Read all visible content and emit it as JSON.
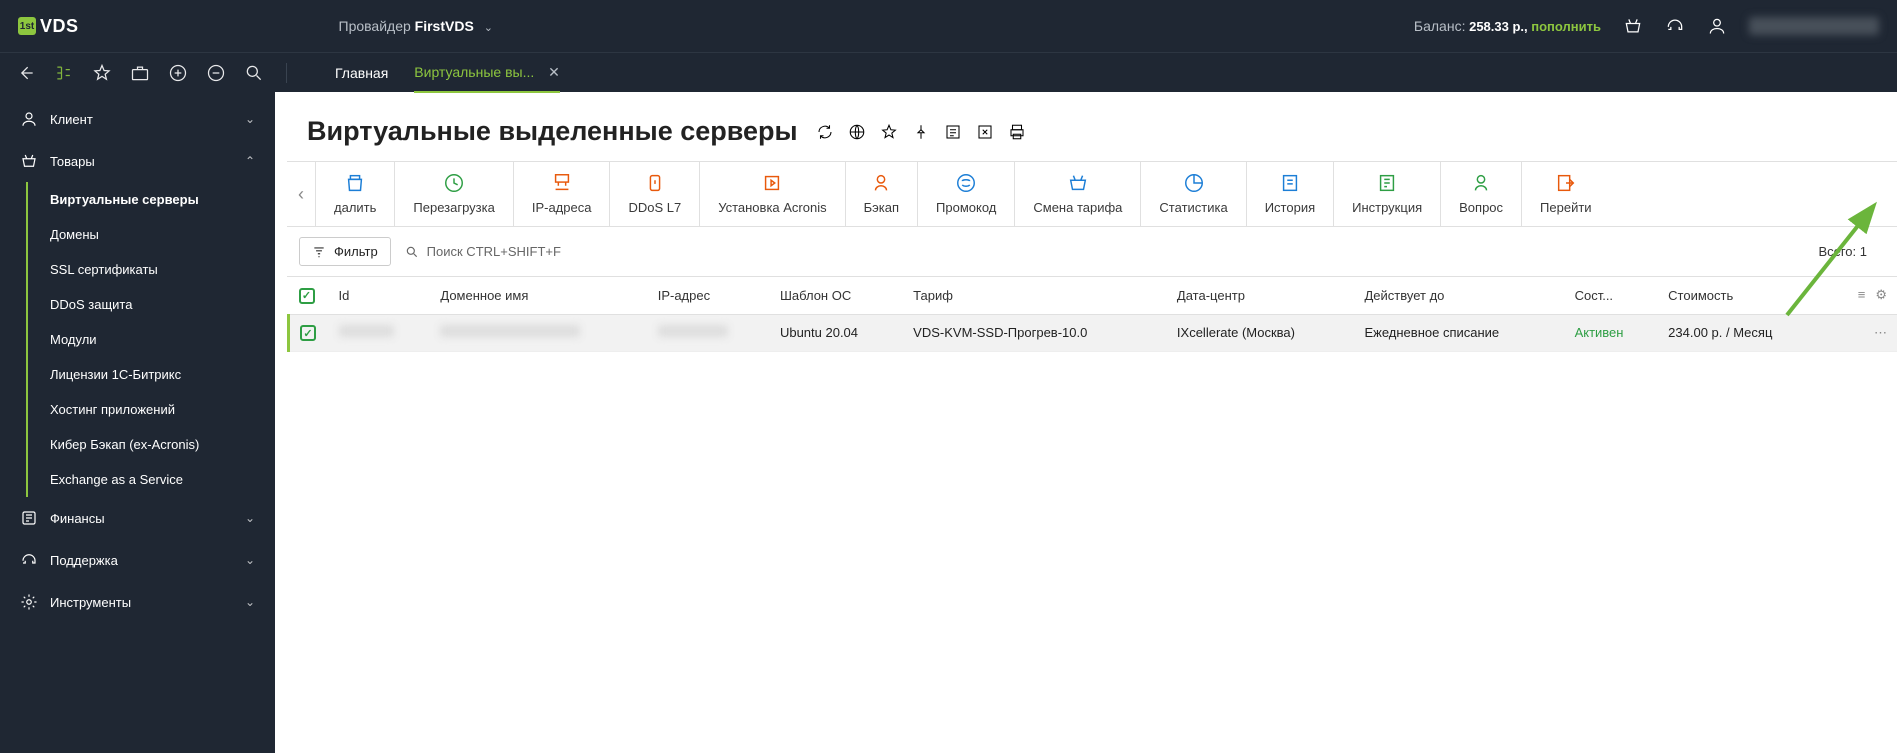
{
  "header": {
    "provider_label": "Провайдер",
    "provider": "FirstVDS",
    "balance_label": "Баланс:",
    "balance_value": "258.33 р.,",
    "topup": "пополнить",
    "user": "████████████"
  },
  "tabs": [
    {
      "label": "Главная",
      "active": false,
      "closable": false
    },
    {
      "label": "Виртуальные вы...",
      "active": true,
      "closable": true
    }
  ],
  "sidebar": [
    {
      "icon": "user",
      "label": "Клиент",
      "open": false
    },
    {
      "icon": "basket",
      "label": "Товары",
      "open": true,
      "items": [
        {
          "label": "Виртуальные серверы",
          "active": true
        },
        {
          "label": "Домены"
        },
        {
          "label": "SSL сертификаты"
        },
        {
          "label": "DDoS защита"
        },
        {
          "label": "Модули"
        },
        {
          "label": "Лицензии 1С-Битрикс"
        },
        {
          "label": "Хостинг приложений"
        },
        {
          "label": "Кибер Бэкап (ex-Acronis)"
        },
        {
          "label": "Exchange as a Service"
        }
      ]
    },
    {
      "icon": "calc",
      "label": "Финансы",
      "open": false
    },
    {
      "icon": "headset",
      "label": "Поддержка",
      "open": false
    },
    {
      "icon": "gear",
      "label": "Инструменты",
      "open": false
    }
  ],
  "page": {
    "title": "Виртуальные выделенные серверы",
    "filter": "Фильтр",
    "search": "Поиск CTRL+SHIFT+F",
    "total_label": "Всего:",
    "total": "1"
  },
  "actions": [
    {
      "label": "далить",
      "col": "blue",
      "name": "delete"
    },
    {
      "label": "Перезагрузка",
      "col": "green",
      "name": "reboot"
    },
    {
      "label": "IP-адреса",
      "col": "orange",
      "name": "ip"
    },
    {
      "label": "DDoS L7",
      "col": "orange",
      "name": "ddos"
    },
    {
      "label": "Установка Acronis",
      "col": "orange",
      "name": "acronis"
    },
    {
      "label": "Бэкап",
      "col": "orange",
      "name": "backup"
    },
    {
      "label": "Промокод",
      "col": "blue",
      "name": "promo"
    },
    {
      "label": "Смена тарифа",
      "col": "blue",
      "name": "tariff"
    },
    {
      "label": "Статистика",
      "col": "blue",
      "name": "stats"
    },
    {
      "label": "История",
      "col": "blue",
      "name": "history"
    },
    {
      "label": "Инструкция",
      "col": "green",
      "name": "instruction"
    },
    {
      "label": "Вопрос",
      "col": "green",
      "name": "question"
    },
    {
      "label": "Перейти",
      "col": "orange",
      "name": "goto"
    }
  ],
  "columns": [
    "Id",
    "Доменное имя",
    "IP-адрес",
    "Шаблон ОС",
    "Тариф",
    "Дата-центр",
    "Действует до",
    "Сост...",
    "Стоимость"
  ],
  "rows": [
    {
      "checked": true,
      "id": "█████",
      "domain": "████████████████",
      "ip": "███████",
      "os": "Ubuntu 20.04",
      "tariff": "VDS-KVM-SSD-Прогрев-10.0",
      "dc": "IXcellerate (Москва)",
      "until": "Ежедневное списание",
      "state": "Активен",
      "cost": "234.00 р. / Месяц"
    }
  ]
}
